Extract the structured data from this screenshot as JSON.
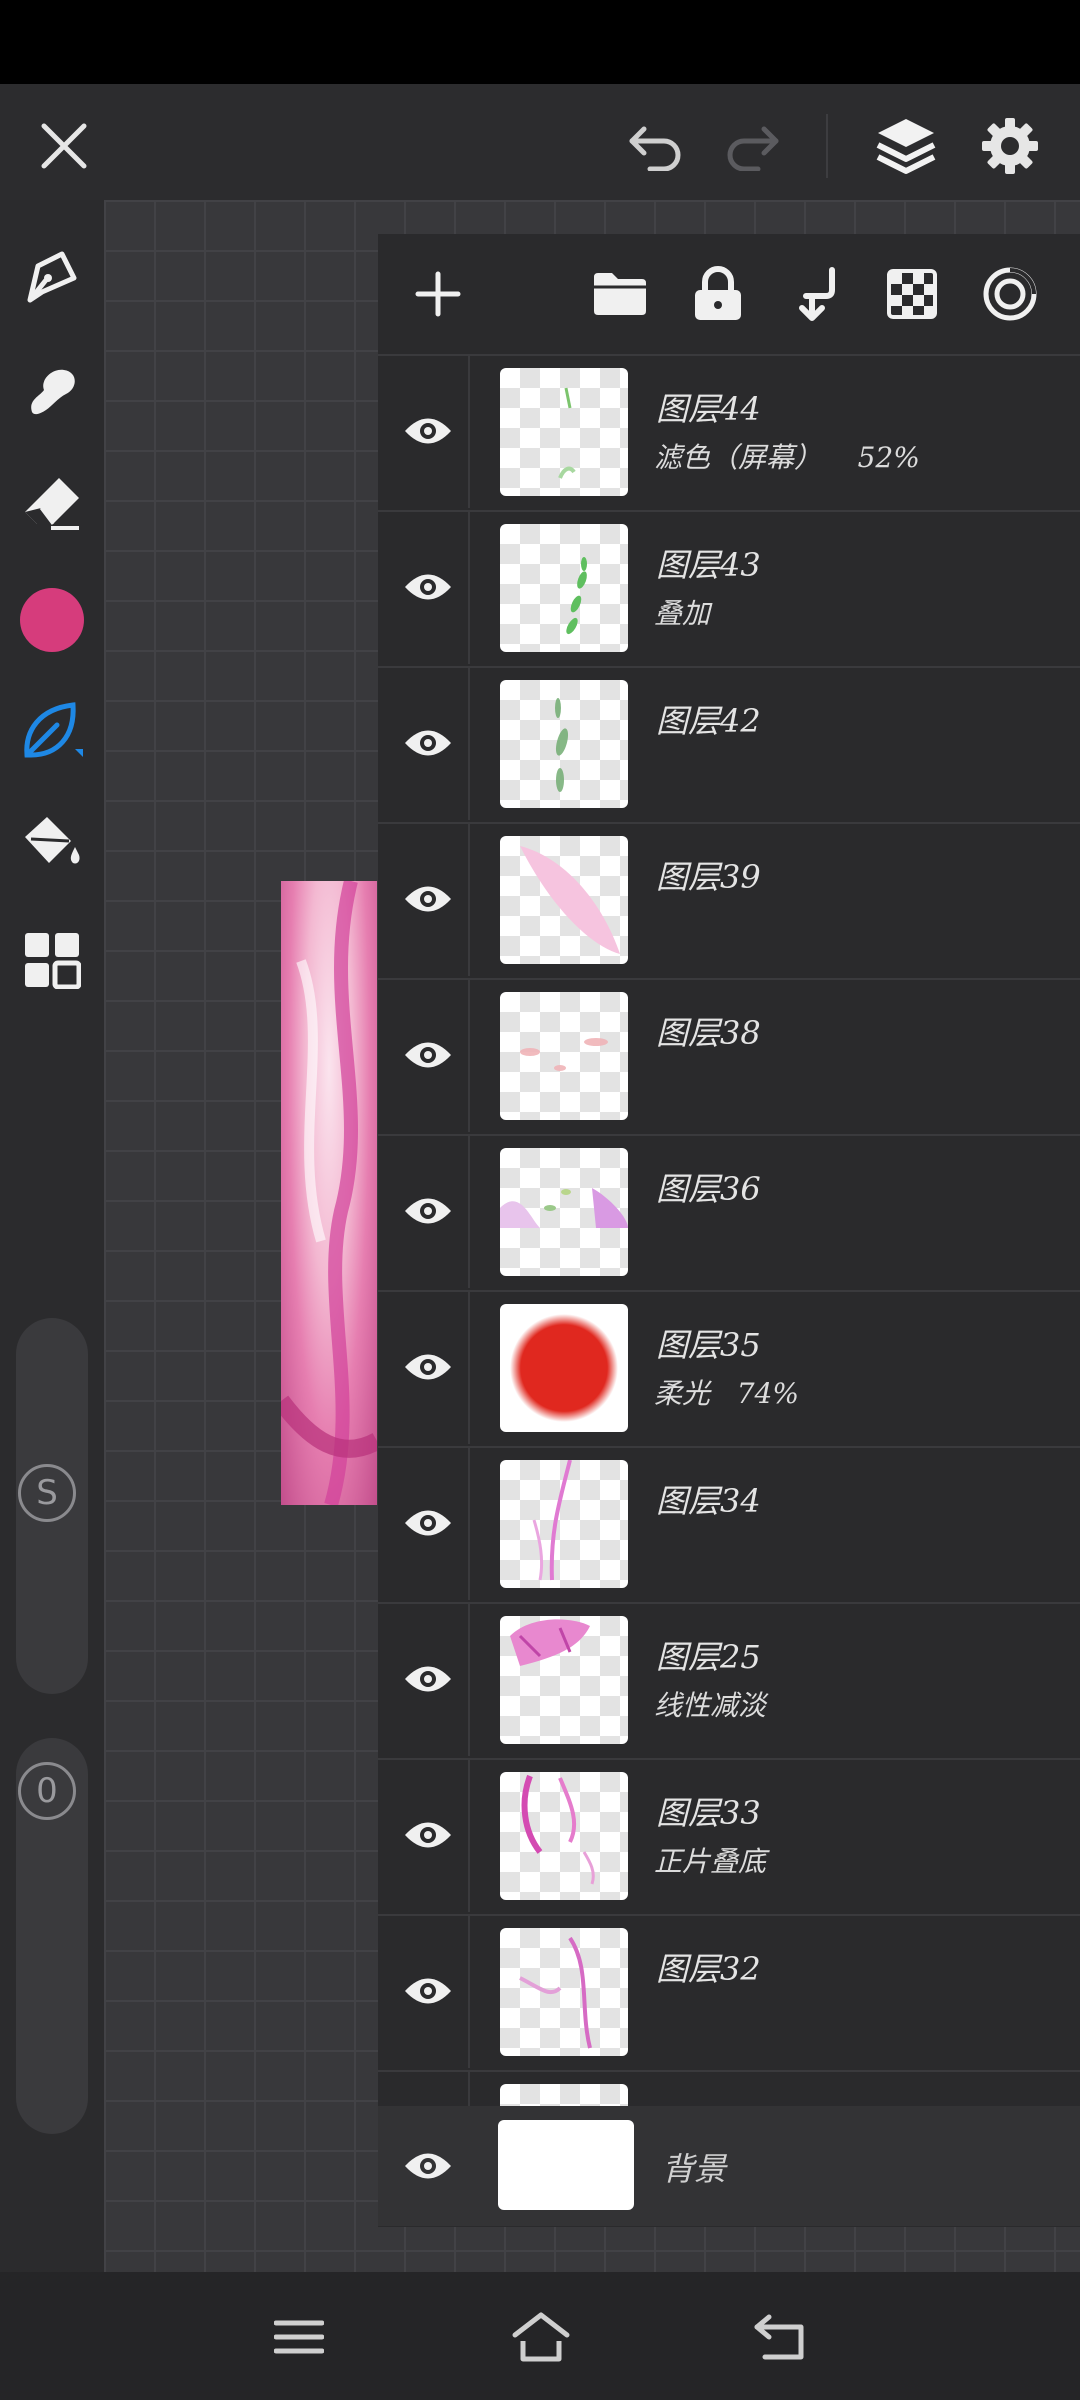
{
  "top_bar": {
    "close": "close-icon",
    "undo": "undo-icon",
    "redo": "redo-icon",
    "layers": "layers-icon",
    "settings": "gear-icon"
  },
  "left_toolbar": {
    "tools": [
      "pen-icon",
      "smudge-icon",
      "eraser-icon",
      "color-swatch",
      "brush-leaf-icon",
      "fill-bucket-icon",
      "grid-menu-icon"
    ],
    "current_color": "#d63c7c",
    "active_tool_color": "#1e88e5",
    "size_badge": "S",
    "opacity_badge": "0"
  },
  "layers_toolbar": [
    "add-icon",
    "folder-icon",
    "lock-icon",
    "merge-down-icon",
    "transparency-icon",
    "target-icon"
  ],
  "layers": [
    {
      "name": "图层44",
      "mode": "滤色（屏幕）    52%",
      "thumb": "green-leaf"
    },
    {
      "name": "图层43",
      "mode": "叠加",
      "thumb": "green-leaves"
    },
    {
      "name": "图层42",
      "mode": "",
      "thumb": "green-stroke"
    },
    {
      "name": "图层39",
      "mode": "",
      "thumb": "pink-stroke"
    },
    {
      "name": "图层38",
      "mode": "",
      "thumb": "faint-pink"
    },
    {
      "name": "图层36",
      "mode": "",
      "thumb": "flowers"
    },
    {
      "name": "图层35",
      "mode": "柔光   74%",
      "thumb": "red-circle"
    },
    {
      "name": "图层34",
      "mode": "",
      "thumb": "pink-line"
    },
    {
      "name": "图层25",
      "mode": "线性减淡",
      "thumb": "pink-hair"
    },
    {
      "name": "图层33",
      "mode": "正片叠底",
      "thumb": "pink-hair-2"
    },
    {
      "name": "图层32",
      "mode": "",
      "thumb": "pink-figure"
    }
  ],
  "background_layer": {
    "name": "背景"
  },
  "bottom_nav": [
    "menu-icon",
    "home-icon",
    "back-icon"
  ]
}
